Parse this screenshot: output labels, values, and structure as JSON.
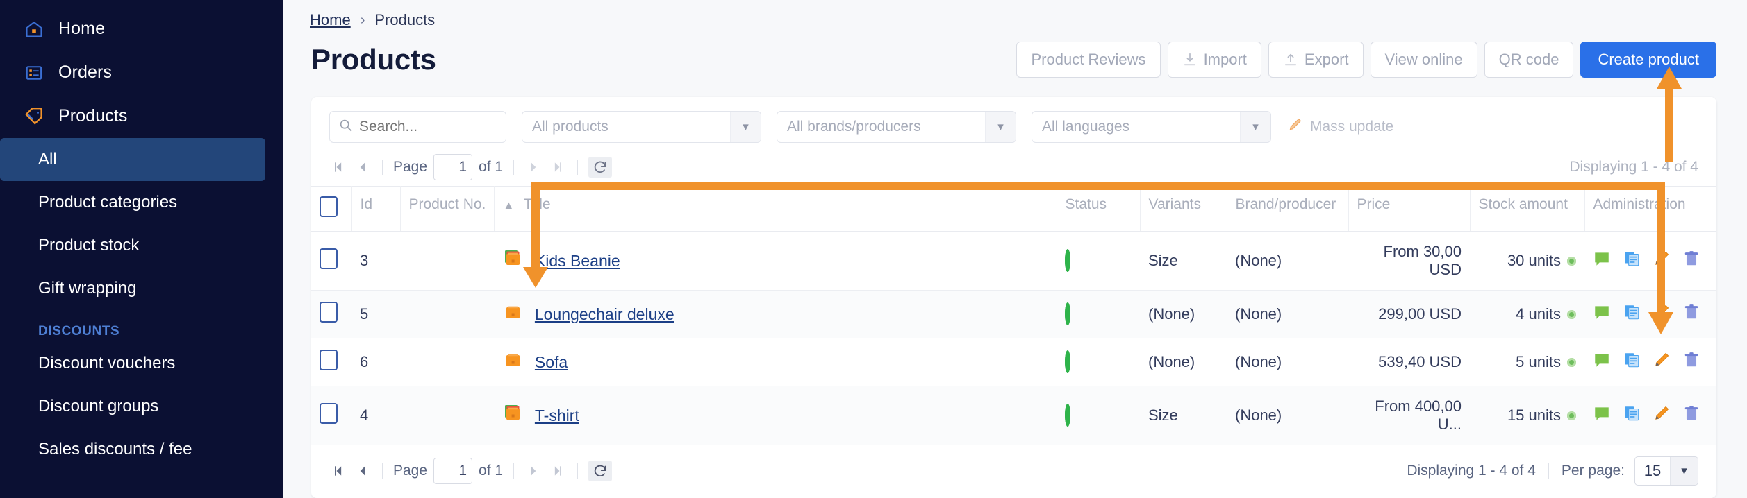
{
  "sidebar": {
    "main_items": [
      {
        "label": "Home",
        "icon": "home-icon"
      },
      {
        "label": "Orders",
        "icon": "orders-icon"
      },
      {
        "label": "Products",
        "icon": "tag-icon"
      }
    ],
    "product_items": [
      {
        "label": "All",
        "active": true
      },
      {
        "label": "Product categories",
        "active": false
      },
      {
        "label": "Product stock",
        "active": false
      },
      {
        "label": "Gift wrapping",
        "active": false
      }
    ],
    "discounts_heading": "DISCOUNTS",
    "discount_items": [
      {
        "label": "Discount vouchers"
      },
      {
        "label": "Discount groups"
      },
      {
        "label": "Sales discounts / fee"
      }
    ],
    "active_bg": "#23467a",
    "bg": "#0b1033"
  },
  "breadcrumb": {
    "home": "Home",
    "separator": "›",
    "current": "Products"
  },
  "header": {
    "title": "Products",
    "buttons": [
      {
        "label": "Product Reviews",
        "icon": null,
        "primary": false
      },
      {
        "label": "Import",
        "icon": "download-icon",
        "primary": false
      },
      {
        "label": "Export",
        "icon": "upload-icon",
        "primary": false
      },
      {
        "label": "View online",
        "icon": null,
        "primary": false
      },
      {
        "label": "QR code",
        "icon": null,
        "primary": false
      },
      {
        "label": "Create product",
        "icon": null,
        "primary": true
      }
    ],
    "primary_color": "#2a70e8"
  },
  "filters": {
    "search_placeholder": "Search...",
    "search_value": "",
    "products_select": "All products",
    "brands_select": "All brands/producers",
    "languages_select": "All languages",
    "mass_update": "Mass update"
  },
  "top_pager": {
    "page_label": "Page",
    "page_value": "1",
    "of_label": "of 1",
    "displaying": "Displaying 1 - 4 of 4"
  },
  "table": {
    "columns": [
      "Id",
      "Product No.",
      "Title",
      "Status",
      "Variants",
      "Brand/producer",
      "Price",
      "Stock amount",
      "Administration"
    ],
    "sort_column": "Title",
    "sort_direction": "asc",
    "rows": [
      {
        "id": "3",
        "product_no": "",
        "title": "Kids Beanie",
        "status": "active",
        "variants": "Size",
        "brand": "(None)",
        "price": "From 30,00 USD",
        "stock": "30 units",
        "actions": [
          "comment-icon",
          "copy-icon",
          "edit-pencil-icon",
          "delete-trash-icon"
        ]
      },
      {
        "id": "5",
        "product_no": "",
        "title": "Loungechair deluxe",
        "status": "active",
        "variants": "(None)",
        "brand": "(None)",
        "price": "299,00 USD",
        "stock": "4 units",
        "actions": [
          "comment-icon",
          "copy-icon",
          "edit-pencil-icon",
          "delete-trash-icon"
        ]
      },
      {
        "id": "6",
        "product_no": "",
        "title": "Sofa",
        "status": "active",
        "variants": "(None)",
        "brand": "(None)",
        "price": "539,40 USD",
        "stock": "5 units",
        "actions": [
          "comment-icon",
          "copy-icon",
          "edit-pencil-icon",
          "delete-trash-icon"
        ]
      },
      {
        "id": "4",
        "product_no": "",
        "title": "T-shirt",
        "status": "active",
        "variants": "Size",
        "brand": "(None)",
        "price": "From 400,00 U...",
        "stock": "15 units",
        "actions": [
          "comment-icon",
          "copy-icon",
          "edit-pencil-icon",
          "delete-trash-icon"
        ]
      }
    ]
  },
  "footer": {
    "page_label": "Page",
    "page_value": "1",
    "of_label": "of 1",
    "displaying": "Displaying 1 - 4 of 4",
    "per_page_label": "Per page:",
    "per_page_value": "15"
  },
  "annotation": {
    "color": "#f0922b"
  }
}
